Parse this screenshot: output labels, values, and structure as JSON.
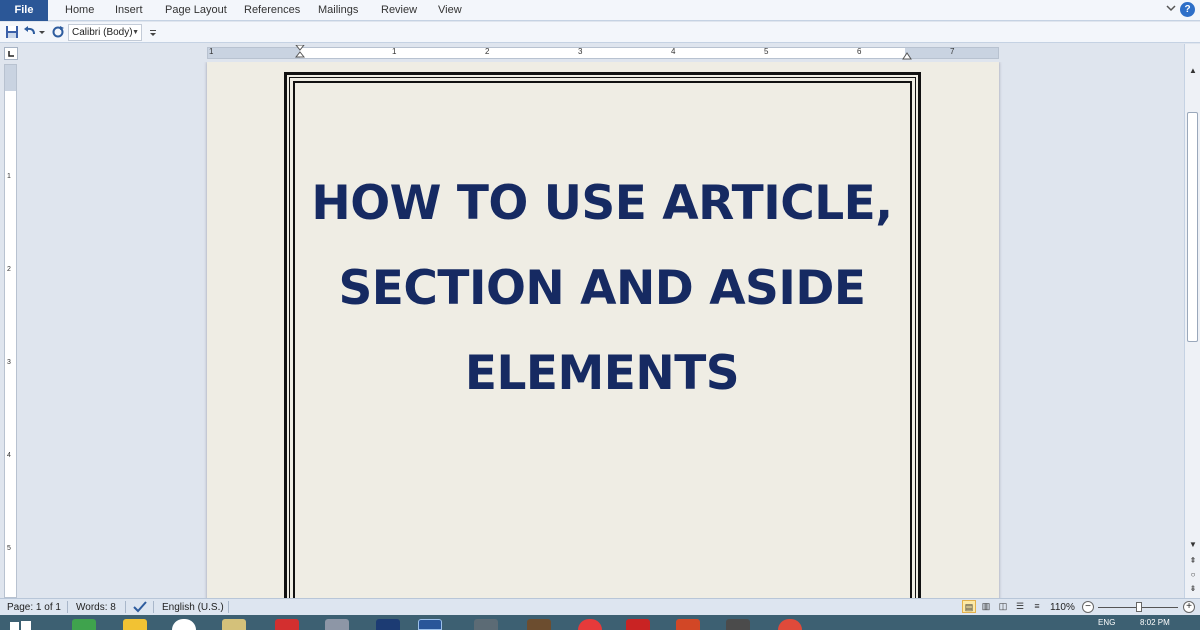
{
  "ribbon": {
    "file_label": "File",
    "tabs": [
      "Home",
      "Insert",
      "Page Layout",
      "References",
      "Mailings",
      "Review",
      "View"
    ],
    "help_label": "?"
  },
  "quick_access": {
    "font_name": "Calibri (Body)"
  },
  "ruler": {
    "numbers": [
      "1",
      "1",
      "2",
      "3",
      "4",
      "5",
      "6",
      "7"
    ],
    "vertical_numbers": [
      "1",
      "2",
      "3",
      "4",
      "5"
    ]
  },
  "document": {
    "title_lines": [
      "HOW TO USE ARTICLE,",
      "SECTION AND ASIDE",
      "ELEMENTS"
    ],
    "title_color": "#162a62",
    "page_color": "#efede4"
  },
  "statusbar": {
    "page": "Page: 1 of 1",
    "words": "Words: 8",
    "language": "English (U.S.)",
    "zoom": "110%"
  },
  "taskbar": {
    "language": "ENG",
    "time": "8:02 PM",
    "icons": [
      "windows-start",
      "app-green",
      "internet-explorer",
      "hp",
      "folder",
      "adobe-reader",
      "mail",
      "bluetooth",
      "word",
      "media",
      "tv",
      "record",
      "pdf",
      "powerpoint",
      "sketch",
      "chrome"
    ]
  },
  "colors": {
    "accent": "#2b5797",
    "ribbon_bg": "#f3f6fb",
    "workspace_bg": "#dfe5ee"
  }
}
